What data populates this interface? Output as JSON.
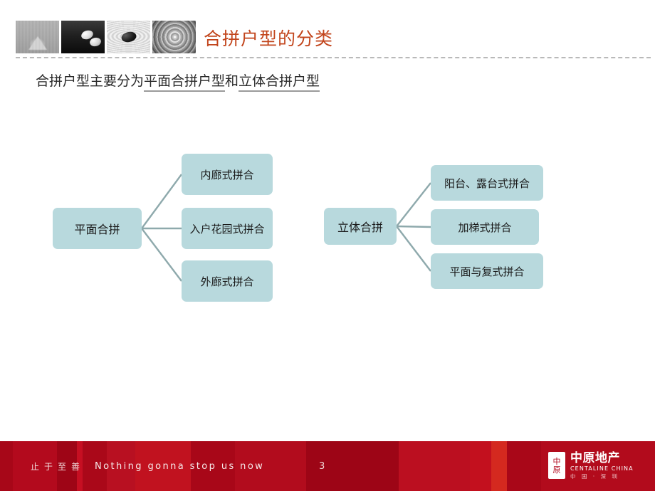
{
  "header": {
    "title": "合拼户型的分类",
    "title_color": "#c2451c",
    "images": [
      {
        "name": "sand-cone-photo"
      },
      {
        "name": "white-stones-photo"
      },
      {
        "name": "black-stone-ripples-photo"
      },
      {
        "name": "water-ripples-photo"
      }
    ]
  },
  "subtitle": {
    "lead": "合拼户型主要分为",
    "term_1": "平面合拼户型",
    "conjunction": "和",
    "term_2": "立体合拼户型"
  },
  "diagram": {
    "node_color": "#b8d9dd",
    "connector_color": "#8ea9ac",
    "left": {
      "root": "平面合拼",
      "children": [
        "内廊式拼合",
        "入户花园式拼合",
        "外廊式拼合"
      ]
    },
    "right": {
      "root": "立体合拼",
      "children": [
        "阳台、露台式拼合",
        "加梯式拼合",
        "平面与复式拼合"
      ]
    }
  },
  "footer": {
    "background": "#b1061b",
    "slogan_cn": "止于至善",
    "slogan_en": "Nothing gonna stop us now",
    "page_number": "3",
    "logo": {
      "badge_top": "中",
      "badge_bottom": "原",
      "name_cn": "中原地产",
      "name_en": "CENTALINE CHINA",
      "region": "中 国 · 深 圳"
    }
  }
}
